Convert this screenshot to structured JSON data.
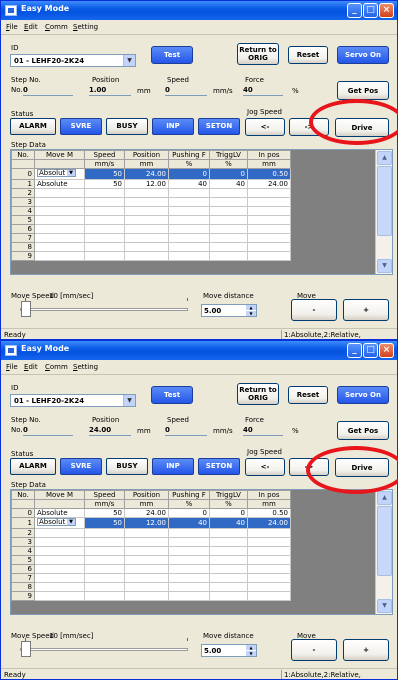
{
  "windows": [
    {
      "title": "Easy Mode",
      "menu": [
        "File",
        "Edit",
        "Comm",
        "Setting"
      ],
      "id_label": "ID",
      "id_value": "01 - LEHF20-2K24",
      "buttons": {
        "test": "Test",
        "return1": "Return to",
        "return2": "ORIG",
        "reset": "Reset",
        "servo": "Servo On"
      },
      "step_no_label": "Step No.",
      "no_label": "No.",
      "step_no_value": "0",
      "position_label": "Position",
      "position_value": "1.00",
      "position_unit": "mm",
      "speed_label": "Speed",
      "speed_value": "0",
      "speed_unit": "mm/s",
      "force_label": "Force",
      "force_value": "40",
      "force_unit": "%",
      "get_pos": "Get Pos",
      "status_label": "Status",
      "status_buttons": [
        "ALARM",
        "SVRE",
        "BUSY",
        "INP",
        "SETON"
      ],
      "status_active": [
        false,
        true,
        false,
        true,
        true
      ],
      "jog_label": "Jog Speed",
      "jog_left": "<-",
      "jog_right": "->",
      "drive": "Drive",
      "step_data_label": "Step Data",
      "columns": [
        "No.",
        "Move M",
        "Speed",
        "Position",
        "Pushing F",
        "TriggLV",
        "In pos"
      ],
      "units": [
        "",
        "",
        "mm/s",
        "mm",
        "%",
        "%",
        "mm"
      ],
      "selected_row": 0,
      "rows": [
        [
          "0",
          "Absolut",
          "50",
          "24.00",
          "0",
          "0",
          "0.50"
        ],
        [
          "1",
          "Absolute",
          "50",
          "12.00",
          "40",
          "40",
          "24.00"
        ],
        [
          "2",
          "",
          "",
          "",
          "",
          "",
          ""
        ],
        [
          "3",
          "",
          "",
          "",
          "",
          "",
          ""
        ],
        [
          "4",
          "",
          "",
          "",
          "",
          "",
          ""
        ],
        [
          "5",
          "",
          "",
          "",
          "",
          "",
          ""
        ],
        [
          "6",
          "",
          "",
          "",
          "",
          "",
          ""
        ],
        [
          "7",
          "",
          "",
          "",
          "",
          "",
          ""
        ],
        [
          "8",
          "",
          "",
          "",
          "",
          "",
          ""
        ],
        [
          "9",
          "",
          "",
          "",
          "",
          "",
          ""
        ]
      ],
      "move_speed_label": "Move Speed",
      "move_speed_value": "10 [mm/sec]",
      "move_distance_label": "Move distance",
      "move_distance_value": "5.00",
      "move_label": "Move",
      "minus": "-",
      "plus": "+",
      "status_left": "Ready",
      "status_right": "1:Absolute,2:Relative,"
    },
    {
      "title": "Easy Mode",
      "menu": [
        "File",
        "Edit",
        "Comm",
        "Setting"
      ],
      "id_label": "ID",
      "id_value": "01 - LEHF20-2K24",
      "buttons": {
        "test": "Test",
        "return1": "Return to",
        "return2": "ORIG",
        "reset": "Reset",
        "servo": "Servo On"
      },
      "step_no_label": "Step No.",
      "no_label": "No.",
      "step_no_value": "0",
      "position_label": "Position",
      "position_value": "24.00",
      "position_unit": "mm",
      "speed_label": "Speed",
      "speed_value": "0",
      "speed_unit": "mm/s",
      "force_label": "Force",
      "force_value": "40",
      "force_unit": "%",
      "get_pos": "Get Pos",
      "status_label": "Status",
      "status_buttons": [
        "ALARM",
        "SVRE",
        "BUSY",
        "INP",
        "SETON"
      ],
      "status_active": [
        false,
        true,
        false,
        true,
        true
      ],
      "jog_label": "Jog Speed",
      "jog_left": "<-",
      "jog_right": "->",
      "drive": "Drive",
      "step_data_label": "Step Data",
      "columns": [
        "No.",
        "Move M",
        "Speed",
        "Position",
        "Pushing F",
        "TriggLV",
        "In pos"
      ],
      "units": [
        "",
        "",
        "mm/s",
        "mm",
        "%",
        "%",
        "mm"
      ],
      "selected_row": 1,
      "rows": [
        [
          "0",
          "Absolute",
          "50",
          "24.00",
          "0",
          "0",
          "0.50"
        ],
        [
          "1",
          "Absolut",
          "50",
          "12.00",
          "40",
          "40",
          "24.00"
        ],
        [
          "2",
          "",
          "",
          "",
          "",
          "",
          ""
        ],
        [
          "3",
          "",
          "",
          "",
          "",
          "",
          ""
        ],
        [
          "4",
          "",
          "",
          "",
          "",
          "",
          ""
        ],
        [
          "5",
          "",
          "",
          "",
          "",
          "",
          ""
        ],
        [
          "6",
          "",
          "",
          "",
          "",
          "",
          ""
        ],
        [
          "7",
          "",
          "",
          "",
          "",
          "",
          ""
        ],
        [
          "8",
          "",
          "",
          "",
          "",
          "",
          ""
        ],
        [
          "9",
          "",
          "",
          "",
          "",
          "",
          ""
        ]
      ],
      "move_speed_label": "Move Speed",
      "move_speed_value": "10 [mm/sec]",
      "move_distance_label": "Move distance",
      "move_distance_value": "5.00",
      "move_label": "Move",
      "minus": "-",
      "plus": "+",
      "status_left": "Ready",
      "status_right": "1:Absolute,2:Relative,"
    }
  ],
  "colors": {
    "accent": "#2456e8",
    "highlight_circle": "#e8151b",
    "selection": "#316ac5"
  }
}
